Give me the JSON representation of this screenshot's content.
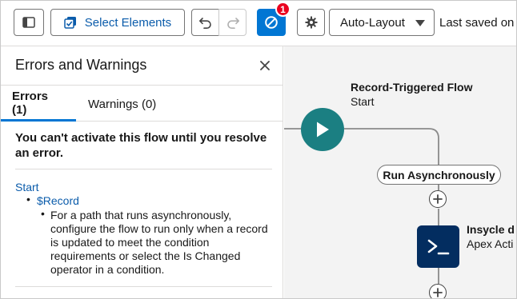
{
  "toolbar": {
    "select_elements_label": "Select Elements",
    "error_count": "1",
    "layout_value": "Auto-Layout",
    "last_saved": "Last saved on"
  },
  "panel": {
    "title": "Errors and Warnings",
    "tabs": [
      {
        "label": "Errors (1)",
        "active": true
      },
      {
        "label": "Warnings (0)",
        "active": false
      }
    ],
    "message": "You can't activate this flow until you resolve an error.",
    "error": {
      "element": "Start",
      "field": "$Record",
      "detail": "For a path that runs asynchronously, configure the flow to run only when a record is updated to meet the condition requirements or select the Is Changed operator in a condition."
    }
  },
  "canvas": {
    "start_title": "Record-Triggered Flow",
    "start_subtitle": "Start",
    "path_label": "Run Asynchronously",
    "action_title": "Insycle d",
    "action_subtitle": "Apex Acti"
  },
  "colors": {
    "brand_blue": "#0176d3",
    "link_blue": "#0b5cab",
    "start_teal": "#1b7f82",
    "apex_navy": "#032d60",
    "error_red": "#ea001e"
  },
  "icons": [
    "panel-toggle-icon",
    "select-elements-icon",
    "undo-icon",
    "redo-icon",
    "error-ban-icon",
    "gear-icon",
    "chevron-down-icon",
    "close-icon",
    "play-icon",
    "plus-icon",
    "apex-terminal-icon"
  ]
}
